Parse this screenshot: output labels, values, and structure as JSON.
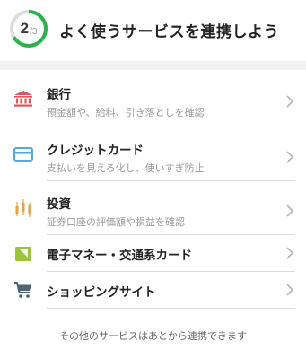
{
  "header": {
    "progress": {
      "current": "2",
      "separator": "/",
      "total": "3",
      "fraction": 0.667
    },
    "title": "よく使うサービスを連携しよう",
    "colors": {
      "accent": "#2ab24b",
      "track": "#dddddd"
    }
  },
  "services": [
    {
      "icon": "bank-icon",
      "title": "銀行",
      "subtitle": "預金額や、給料、引き落としを確認",
      "color": "#d9575c"
    },
    {
      "icon": "credit-card-icon",
      "title": "クレジットカード",
      "subtitle": "支払いを見える化し、使いすぎ防止",
      "color": "#56a9d9"
    },
    {
      "icon": "investment-icon",
      "title": "投資",
      "subtitle": "証券口座の評価額や損益を確認",
      "color": "#e6a33c"
    },
    {
      "icon": "e-money-icon",
      "title": "電子マネー・交通系カード",
      "subtitle": "",
      "color": "#9bc43c"
    },
    {
      "icon": "shopping-cart-icon",
      "title": "ショッピングサイト",
      "subtitle": "",
      "color": "#4c6475"
    }
  ],
  "footer": {
    "text": "その他のサービスはあとから連携できます"
  }
}
